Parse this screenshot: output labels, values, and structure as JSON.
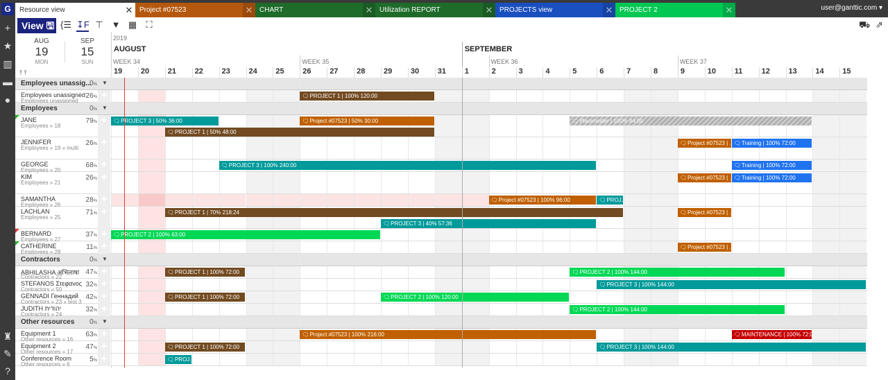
{
  "app": {
    "logo": "G",
    "user": "user@ganttic.com ▾"
  },
  "sidebar": [
    {
      "icon": "plus-icon",
      "glyph": "+"
    },
    {
      "icon": "star-icon",
      "glyph": "★"
    },
    {
      "icon": "report-icon",
      "glyph": "▥"
    },
    {
      "icon": "archive-icon",
      "glyph": "▬"
    },
    {
      "icon": "drop-icon",
      "glyph": "●"
    },
    {
      "icon": "org-icon",
      "glyph": "♜"
    },
    {
      "icon": "wrench-icon",
      "glyph": "✎"
    },
    {
      "icon": "help-icon",
      "glyph": "?"
    }
  ],
  "tabs": [
    {
      "label": "Resource view",
      "color": "#ffffff",
      "active": true
    },
    {
      "label": "Project #07523",
      "color": "#b5580f"
    },
    {
      "label": "CHART",
      "color": "#1e6b2a"
    },
    {
      "label": "Utilization REPORT",
      "color": "#1e6b2a"
    },
    {
      "label": "PROJECTS view",
      "color": "#1a4fbf"
    },
    {
      "label": "PROJECT 2",
      "color": "#00c853"
    }
  ],
  "toolbar": {
    "view_label": "View",
    "save_icon": "save-icon",
    "tools": [
      "columns-icon",
      "sort-icon",
      "paint-icon",
      "filter-icon",
      "calendar-icon",
      "fullscreen-icon"
    ],
    "right_tools": [
      "approve-icon",
      "export-icon"
    ]
  },
  "range": {
    "start": {
      "month": "AUG",
      "day": "19",
      "weekday": "MON"
    },
    "end": {
      "month": "SEP",
      "day": "15",
      "weekday": "SUN"
    }
  },
  "timeline": {
    "year": "2019",
    "months": [
      {
        "label": "AUGUST",
        "start": "2019-08-19"
      },
      {
        "label": "SEPTEMBER",
        "start": "2019-09-01"
      }
    ],
    "weeks": [
      {
        "label": "WEEK 34",
        "start": "2019-08-19"
      },
      {
        "label": "WEEK 35",
        "start": "2019-08-26"
      },
      {
        "label": "WEEK 36",
        "start": "2019-09-02"
      },
      {
        "label": "WEEK 37",
        "start": "2019-09-09"
      }
    ],
    "days": [
      "19",
      "20",
      "21",
      "22",
      "23",
      "24",
      "25",
      "26",
      "27",
      "28",
      "29",
      "30",
      "31",
      "1",
      "2",
      "3",
      "4",
      "5",
      "6",
      "7",
      "8",
      "9",
      "10",
      "11",
      "12",
      "13",
      "14",
      "15"
    ],
    "weekends": [
      "2019-08-24",
      "2019-08-25",
      "2019-08-31",
      "2019-09-01",
      "2019-09-07",
      "2019-09-08",
      "2019-09-14",
      "2019-09-15"
    ],
    "holidays": [
      "2019-08-20"
    ],
    "today": "2019-08-19"
  },
  "colors": {
    "PROJECT 1": "#724b22",
    "PROJECT 2": "#00d855",
    "PROJECT 3": "#009a9a",
    "Project #07523": "#c06000",
    "Training": "#2073f0",
    "Placeholder": "#b0b0b0",
    "MAINTENANCE": "#e00000"
  },
  "rows": [
    {
      "type": "group",
      "name": "Employees unassig...",
      "pct": "0"
    },
    {
      "name": "Employees unassigned",
      "sub": "Employees unassigned",
      "pct": "26",
      "lanes": 1,
      "bars": [
        {
          "p": "PROJECT 1",
          "label": "PROJECT 1 | 100% 120:00",
          "start": "2019-08-26",
          "end": "2019-08-30"
        }
      ]
    },
    {
      "type": "group",
      "name": "Employees",
      "pct": "0"
    },
    {
      "name": "JANE",
      "sub": "Employees » 18",
      "pct": "79",
      "lanes": 2,
      "flag": "#2db82d",
      "bars": [
        {
          "p": "PROJECT 3",
          "label": "PROJECT 3 | 50% 36:00",
          "start": "2019-08-19",
          "end": "2019-08-22"
        },
        {
          "p": "Project #07523",
          "label": "Project #07523 | 50% 30:00",
          "start": "2019-08-26",
          "end": "2019-08-30"
        },
        {
          "p": "Placeholder",
          "label": "Placeholder | 100% 84:00",
          "start": "2019-09-05",
          "end": "2019-09-13",
          "hatch": true
        },
        {
          "p": "PROJECT 1",
          "label": "PROJECT 1 | 50% 48:00",
          "start": "2019-08-21",
          "end": "2019-08-30",
          "lane": 1
        }
      ]
    },
    {
      "name": "JENNIFER",
      "sub": "Employees » 19 » multi",
      "pct": "26",
      "lanes": 2,
      "bars": [
        {
          "p": "Project #07523",
          "label": "Project #07523 | ...",
          "start": "2019-09-09",
          "end": "2019-09-10"
        },
        {
          "p": "Training",
          "label": "Training | 100% 72:00",
          "start": "2019-09-11",
          "end": "2019-09-13"
        }
      ]
    },
    {
      "name": "GEORGE",
      "sub": "Employees » 20",
      "pct": "68",
      "lanes": 1,
      "bars": [
        {
          "p": "PROJECT 3",
          "label": "PROJECT 3 | 100% 240:00",
          "start": "2019-08-23",
          "end": "2019-09-05"
        },
        {
          "p": "Training",
          "label": "Training | 100% 72:00",
          "start": "2019-09-11",
          "end": "2019-09-13"
        }
      ]
    },
    {
      "name": "KIM",
      "sub": "Employees » 21",
      "pct": "26",
      "lanes": 2,
      "bars": [
        {
          "p": "Project #07523",
          "label": "Project #07523 | ...",
          "start": "2019-09-09",
          "end": "2019-09-10"
        },
        {
          "p": "Training",
          "label": "Training | 100% 72:00",
          "start": "2019-09-11",
          "end": "2019-09-13"
        }
      ]
    },
    {
      "name": "SAMANTHA",
      "sub": "Employees » 26",
      "pct": "28",
      "lanes": 1,
      "absent_until": "2019-09-01",
      "bars": [
        {
          "p": "Project #07523",
          "label": "Project #07523 | 100% 96:00",
          "start": "2019-09-02",
          "end": "2019-09-05"
        },
        {
          "p": "PROJECT 3",
          "label": "PROJ...",
          "start": "2019-09-06",
          "end": "2019-09-06"
        }
      ]
    },
    {
      "name": "LACHLAN",
      "sub": "Employees » 25",
      "pct": "71",
      "lanes": 2,
      "bars": [
        {
          "p": "PROJECT 1",
          "label": "PROJECT 1 | 70% 218:24",
          "start": "2019-08-21",
          "end": "2019-09-06"
        },
        {
          "p": "Project #07523",
          "label": "Project #07523 | ...",
          "start": "2019-09-09",
          "end": "2019-09-10"
        },
        {
          "p": "PROJECT 3",
          "label": "PROJECT 3 | 40% 57:36",
          "start": "2019-08-29",
          "end": "2019-09-05",
          "lane": 1
        }
      ]
    },
    {
      "name": "BERNARD",
      "sub": "Employees » 27",
      "pct": "37",
      "lanes": 1,
      "flag": "#e53935",
      "bars": [
        {
          "p": "PROJECT 2",
          "label": "PROJECT 2 | 100% 63:00",
          "start": "2019-08-19",
          "end": "2019-08-28"
        }
      ]
    },
    {
      "name": "CATHERINE",
      "sub": "Employees » 28",
      "pct": "11",
      "lanes": 1,
      "flag": "#2db82d",
      "bars": [
        {
          "p": "Project #07523",
          "label": "Project #07523 | ...",
          "start": "2019-09-09",
          "end": "2019-09-10"
        }
      ]
    },
    {
      "type": "group",
      "name": "Contractors",
      "pct": "0"
    },
    {
      "name": "ABHILASHA अभिलाषा",
      "sub": "Contractors » 22",
      "pct": "47",
      "lanes": 1,
      "bars": [
        {
          "p": "PROJECT 1",
          "label": "PROJECT 1 | 100% 72:00",
          "start": "2019-08-21",
          "end": "2019-08-23"
        },
        {
          "p": "PROJECT 2",
          "label": "PROJECT 2 | 100% 144:00",
          "start": "2019-09-05",
          "end": "2019-09-12"
        }
      ]
    },
    {
      "name": "STEFANOS Στεφανος",
      "sub": "Contractors » 50",
      "pct": "32",
      "lanes": 1,
      "bars": [
        {
          "p": "PROJECT 3",
          "label": "PROJECT 3 | 100% 144:00",
          "start": "2019-09-06",
          "end": "2019-09-15"
        }
      ]
    },
    {
      "name": "GENNADI Геннадий",
      "sub": "Contractors » 23 » test 3",
      "pct": "42",
      "lanes": 1,
      "bars": [
        {
          "p": "PROJECT 1",
          "label": "PROJECT 1 | 100% 72:00",
          "start": "2019-08-21",
          "end": "2019-08-23"
        },
        {
          "p": "PROJECT 2",
          "label": "PROJECT 2 | 100% 120:00",
          "start": "2019-08-29",
          "end": "2019-09-04"
        }
      ]
    },
    {
      "name": "JUDITH יהודית",
      "sub": "Contractors » 24",
      "pct": "32",
      "lanes": 1,
      "bars": [
        {
          "p": "PROJECT 2",
          "label": "PROJECT 2 | 100% 144:00",
          "start": "2019-09-05",
          "end": "2019-09-12"
        }
      ]
    },
    {
      "type": "group",
      "name": "Other resources",
      "pct": "0"
    },
    {
      "name": "Equipment 1",
      "sub": "Other resources » 16",
      "pct": "63",
      "lanes": 1,
      "bars": [
        {
          "p": "Project #07523",
          "label": "Project #07523 | 100% 216:00",
          "start": "2019-08-26",
          "end": "2019-09-05"
        },
        {
          "p": "MAINTENANCE",
          "label": "MAINTENANCE | 100% 72:00",
          "start": "2019-09-11",
          "end": "2019-09-13",
          "hatch": true
        }
      ]
    },
    {
      "name": "Equipment 2",
      "sub": "Other resources » 17",
      "pct": "47",
      "lanes": 1,
      "bars": [
        {
          "p": "PROJECT 1",
          "label": "PROJECT 1 | 100% 72:00",
          "start": "2019-08-21",
          "end": "2019-08-23"
        },
        {
          "p": "PROJECT 3",
          "label": "PROJECT 3 | 100% 144:00",
          "start": "2019-09-06",
          "end": "2019-09-15"
        }
      ]
    },
    {
      "name": "Conference Room",
      "sub": "Other resources » 6",
      "pct": "5",
      "lanes": 1,
      "bars": [
        {
          "p": "PROJECT 3",
          "label": "PROJ...",
          "start": "2019-08-21",
          "end": "2019-08-21"
        }
      ]
    }
  ]
}
